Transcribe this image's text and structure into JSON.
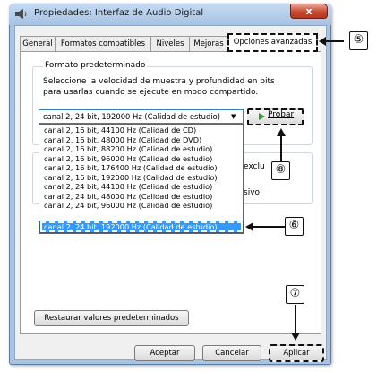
{
  "window": {
    "title": "Propiedades: Interfaz de Audio Digital",
    "close_label": "x"
  },
  "tabs": [
    {
      "label": "General"
    },
    {
      "label": "Formatos compatibles"
    },
    {
      "label": "Niveles"
    },
    {
      "label": "Mejoras"
    },
    {
      "label": "Opciones avanzadas"
    }
  ],
  "format_group": {
    "legend": "Formato predeterminado",
    "description": "Seleccione la velocidad de muestra y profundidad en bits para usarlas cuando se ejecute en modo compartido.",
    "selected_value": "canal 2, 24 bit, 192000 Hz (Calidad de estudio)",
    "test_button": "Probar",
    "options": [
      "canal 2, 16 bit, 44100 Hz (Calidad de CD)",
      "canal 2, 16 bit, 48000 Hz (Calidad de DVD)",
      "canal 2, 16 bit, 88200 Hz (Calidad de estudio)",
      "canal 2, 16 bit, 96000 Hz (Calidad de estudio)",
      "canal 2, 16 bit, 176400 Hz (Calidad de estudio)",
      "canal 2, 16 bit, 192000 Hz (Calidad de estudio)",
      "canal 2, 24 bit, 44100 Hz (Calidad de estudio)",
      "canal 2, 24 bit, 48000 Hz (Calidad de estudio)",
      "canal 2, 24 bit, 96000 Hz (Calidad de estudio)",
      "canal 2, 24 bit, 192000 Hz (Calidad de estudio)"
    ]
  },
  "exclusive_group": {
    "fragment_1": "exclu",
    "fragment_2": "sivo"
  },
  "buttons": {
    "restore": "Restaurar valores predeterminados",
    "accept": "Aceptar",
    "cancel": "Cancelar",
    "apply": "Aplicar"
  },
  "callouts": {
    "c5": "⑤",
    "c6": "⑥",
    "c7": "⑦",
    "c8": "⑧"
  },
  "colors": {
    "selection": "#3399ff",
    "titlebar": "#a6c2e2",
    "close": "#c9462f",
    "play": "#2e9d34"
  }
}
